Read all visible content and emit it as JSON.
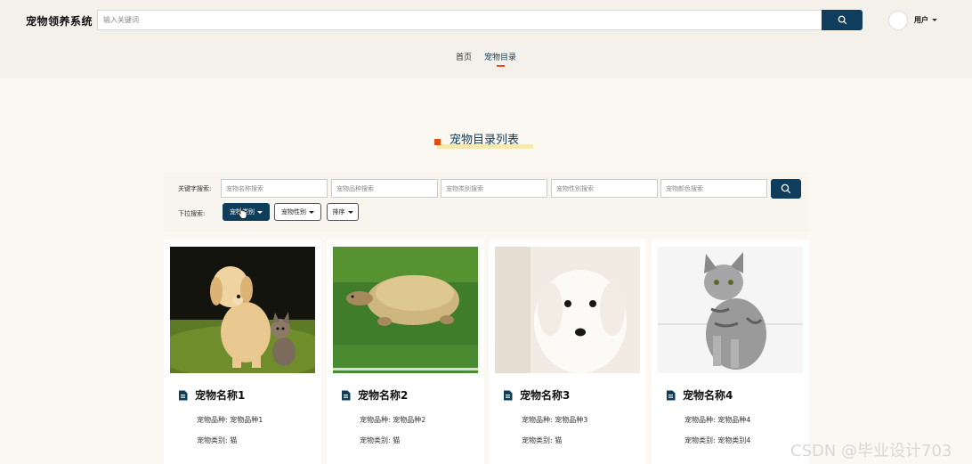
{
  "app": {
    "title": "宠物领养系统"
  },
  "search": {
    "placeholder": "输入关键词"
  },
  "user": {
    "label": "用户"
  },
  "nav": {
    "items": [
      {
        "label": "首页"
      },
      {
        "label": "宠物目录"
      }
    ]
  },
  "section": {
    "title": "宠物目录列表"
  },
  "filters": {
    "keyword_label": "关键字搜索:",
    "dropdown_label": "下拉搜索:",
    "inputs": [
      {
        "placeholder": "宠物名称搜索"
      },
      {
        "placeholder": "宠物品种搜索"
      },
      {
        "placeholder": "宠物类别搜索"
      },
      {
        "placeholder": "宠物性别搜索"
      },
      {
        "placeholder": "宠物颜色搜索"
      }
    ],
    "dropdowns": [
      {
        "label": "宠物类别"
      },
      {
        "label": "宠物性别"
      },
      {
        "label": "排序"
      }
    ]
  },
  "pets": [
    {
      "name": "宠物名称1",
      "breed_label": "宠物品种:",
      "breed": "宠物品种1",
      "category_label": "宠物类别:",
      "category": "猫",
      "image": "puppy-and-kitten-photo"
    },
    {
      "name": "宠物名称2",
      "breed_label": "宠物品种:",
      "breed": "宠物品种2",
      "category_label": "宠物类别:",
      "category": "猫",
      "image": "turtle-on-grass-photo"
    },
    {
      "name": "宠物名称3",
      "breed_label": "宠物品种:",
      "breed": "宠物品种3",
      "category_label": "宠物类别:",
      "category": "猫",
      "image": "white-puppy-photo"
    },
    {
      "name": "宠物名称4",
      "breed_label": "宠物品种:",
      "breed": "宠物品种4",
      "category_label": "宠物类别:",
      "category": "宠物类别4",
      "image": "tabby-cat-photo"
    }
  ],
  "watermark": "CSDN @毕业设计703",
  "colors": {
    "primary": "#0f3d5c",
    "accent": "#e24d13",
    "background": "#faf8f1",
    "header_bg": "#f4f1ea"
  }
}
